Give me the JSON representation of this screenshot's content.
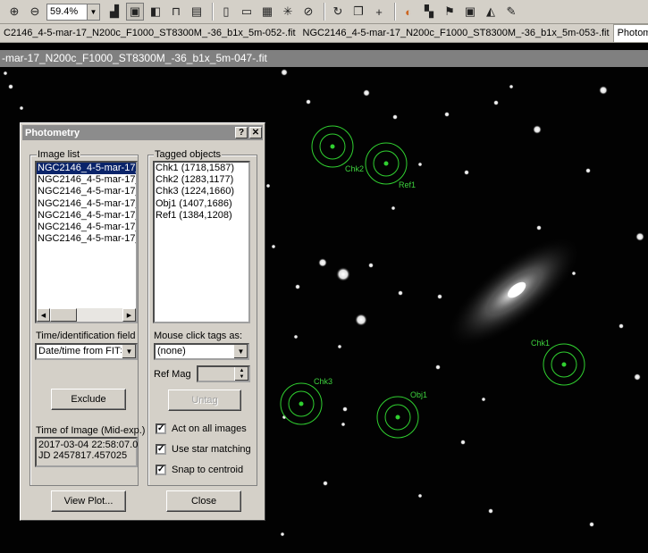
{
  "toolbar": {
    "zoom_value": "59.4%"
  },
  "tabs": [
    {
      "label": "C2146_4-5-mar-17_N200c_F1000_ST8300M_-36_b1x_5m-052-.fit"
    },
    {
      "label": "NGC2146_4-5-mar-17_N200c_F1000_ST8300M_-36_b1x_5m-053-.fit"
    },
    {
      "label": "Photometr"
    }
  ],
  "image_window_title": "-mar-17_N200c_F1000_ST8300M_-36_b1x_5m-047-.fit",
  "tags_overlay": [
    {
      "label": "Chk2"
    },
    {
      "label": "Ref1"
    },
    {
      "label": "Chk1"
    },
    {
      "label": "Chk3"
    },
    {
      "label": "Obj1"
    }
  ],
  "dialog": {
    "title": "Photometry",
    "help_label": "?",
    "close_label": "✕",
    "image_list_label": "Image list",
    "image_list": [
      "NGC2146_4-5-mar-17_",
      "NGC2146_4-5-mar-17_",
      "NGC2146_4-5-mar-17_",
      "NGC2146_4-5-mar-17_",
      "NGC2146_4-5-mar-17_",
      "NGC2146_4-5-mar-17_",
      "NGC2146_4-5-mar-17_"
    ],
    "tagged_objects_label": "Tagged objects",
    "tagged_objects": [
      "Chk1 (1718,1587)",
      "Chk2 (1283,1177)",
      "Chk3 (1224,1660)",
      "Obj1 (1407,1686)",
      "Ref1 (1384,1208)"
    ],
    "time_field_label": "Time/identification field",
    "time_field_value": "Date/time from FITS",
    "mouse_tags_label": "Mouse click tags as:",
    "mouse_tags_value": "(none)",
    "ref_mag_label": "Ref Mag",
    "untag_label": "Untag",
    "exclude_label": "Exclude",
    "time_of_image_label": "Time of Image (Mid-exp.)",
    "time_of_image_line1": "2017-03-04  22:58:07.0",
    "time_of_image_line2": "JD 2457817.457025",
    "act_on_all_label": "Act on all images",
    "use_star_matching_label": "Use star matching",
    "snap_to_centroid_label": "Snap to centroid",
    "view_plot_label": "View Plot...",
    "close_button_label": "Close"
  }
}
